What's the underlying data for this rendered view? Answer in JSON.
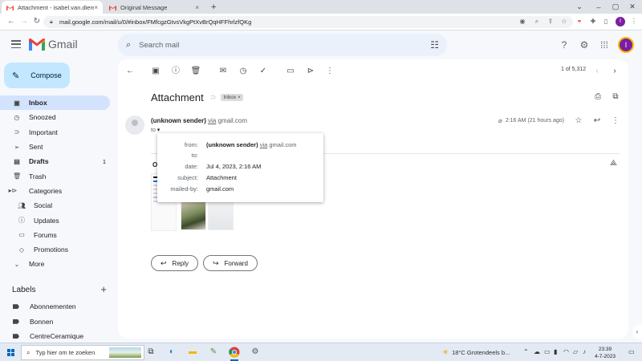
{
  "browser": {
    "tabs": [
      {
        "label": "Attachment - isabel.van.dieren@",
        "close": "×"
      },
      {
        "label": "Original Message",
        "close": "×"
      }
    ],
    "new_tab": "+",
    "url": "mail.google.com/mail/u/0/#inbox/FMfcgzGtvsVkgPtXvBrQqHFFhrlzfQKg",
    "profile_initial": "I"
  },
  "gmail": {
    "app_name": "Gmail",
    "search_placeholder": "Search mail",
    "avatar_initial": "I"
  },
  "sidebar": {
    "compose_label": "Compose",
    "items": [
      {
        "label": "Inbox",
        "icon": "inbox-icon",
        "active": true
      },
      {
        "label": "Snoozed",
        "icon": "clock-icon"
      },
      {
        "label": "Important",
        "icon": "important-icon"
      },
      {
        "label": "Sent",
        "icon": "send-icon"
      },
      {
        "label": "Drafts",
        "icon": "draft-icon",
        "count": "1"
      },
      {
        "label": "Trash",
        "icon": "trash-icon"
      },
      {
        "label": "Categories",
        "icon": "label-icon"
      },
      {
        "label": "Social",
        "icon": "people-icon"
      },
      {
        "label": "Updates",
        "icon": "info-icon"
      },
      {
        "label": "Forums",
        "icon": "forum-icon"
      },
      {
        "label": "Promotions",
        "icon": "tag-icon"
      },
      {
        "label": "More",
        "icon": "chevron-down-icon"
      }
    ],
    "labels_heading": "Labels",
    "labels": [
      "Abonnementen",
      "Bonnen",
      "CentreCeramique"
    ]
  },
  "toolbar": {
    "pager": "1 of 5,312"
  },
  "email": {
    "subject": "Attachment",
    "inbox_chip": "Inbox",
    "chip_close": "×",
    "sender_name": "(unknown sender)",
    "via_word": "via",
    "via_domain": "gmail.com",
    "to_label": "to",
    "time": "2:16 AM (21 hours ago)",
    "attachments_initial": "O",
    "reply_label": "Reply",
    "forward_label": "Forward"
  },
  "details_popup": {
    "from_key": "from:",
    "from_name": "(unknown sender)",
    "from_via": "via",
    "from_domain": "gmail.com",
    "to_key": "to:",
    "date_key": "date:",
    "date_value": "Jul 4, 2023, 2:16 AM",
    "subject_key": "subject:",
    "subject_value": "Attachment",
    "mailedby_key": "mailed-by:",
    "mailedby_value": "gmail.com"
  },
  "taskbar": {
    "search_placeholder": "Typ hier om te zoeken",
    "weather": "18°C  Grotendeels b...",
    "time": "23:39",
    "date": "4-7-2023"
  }
}
